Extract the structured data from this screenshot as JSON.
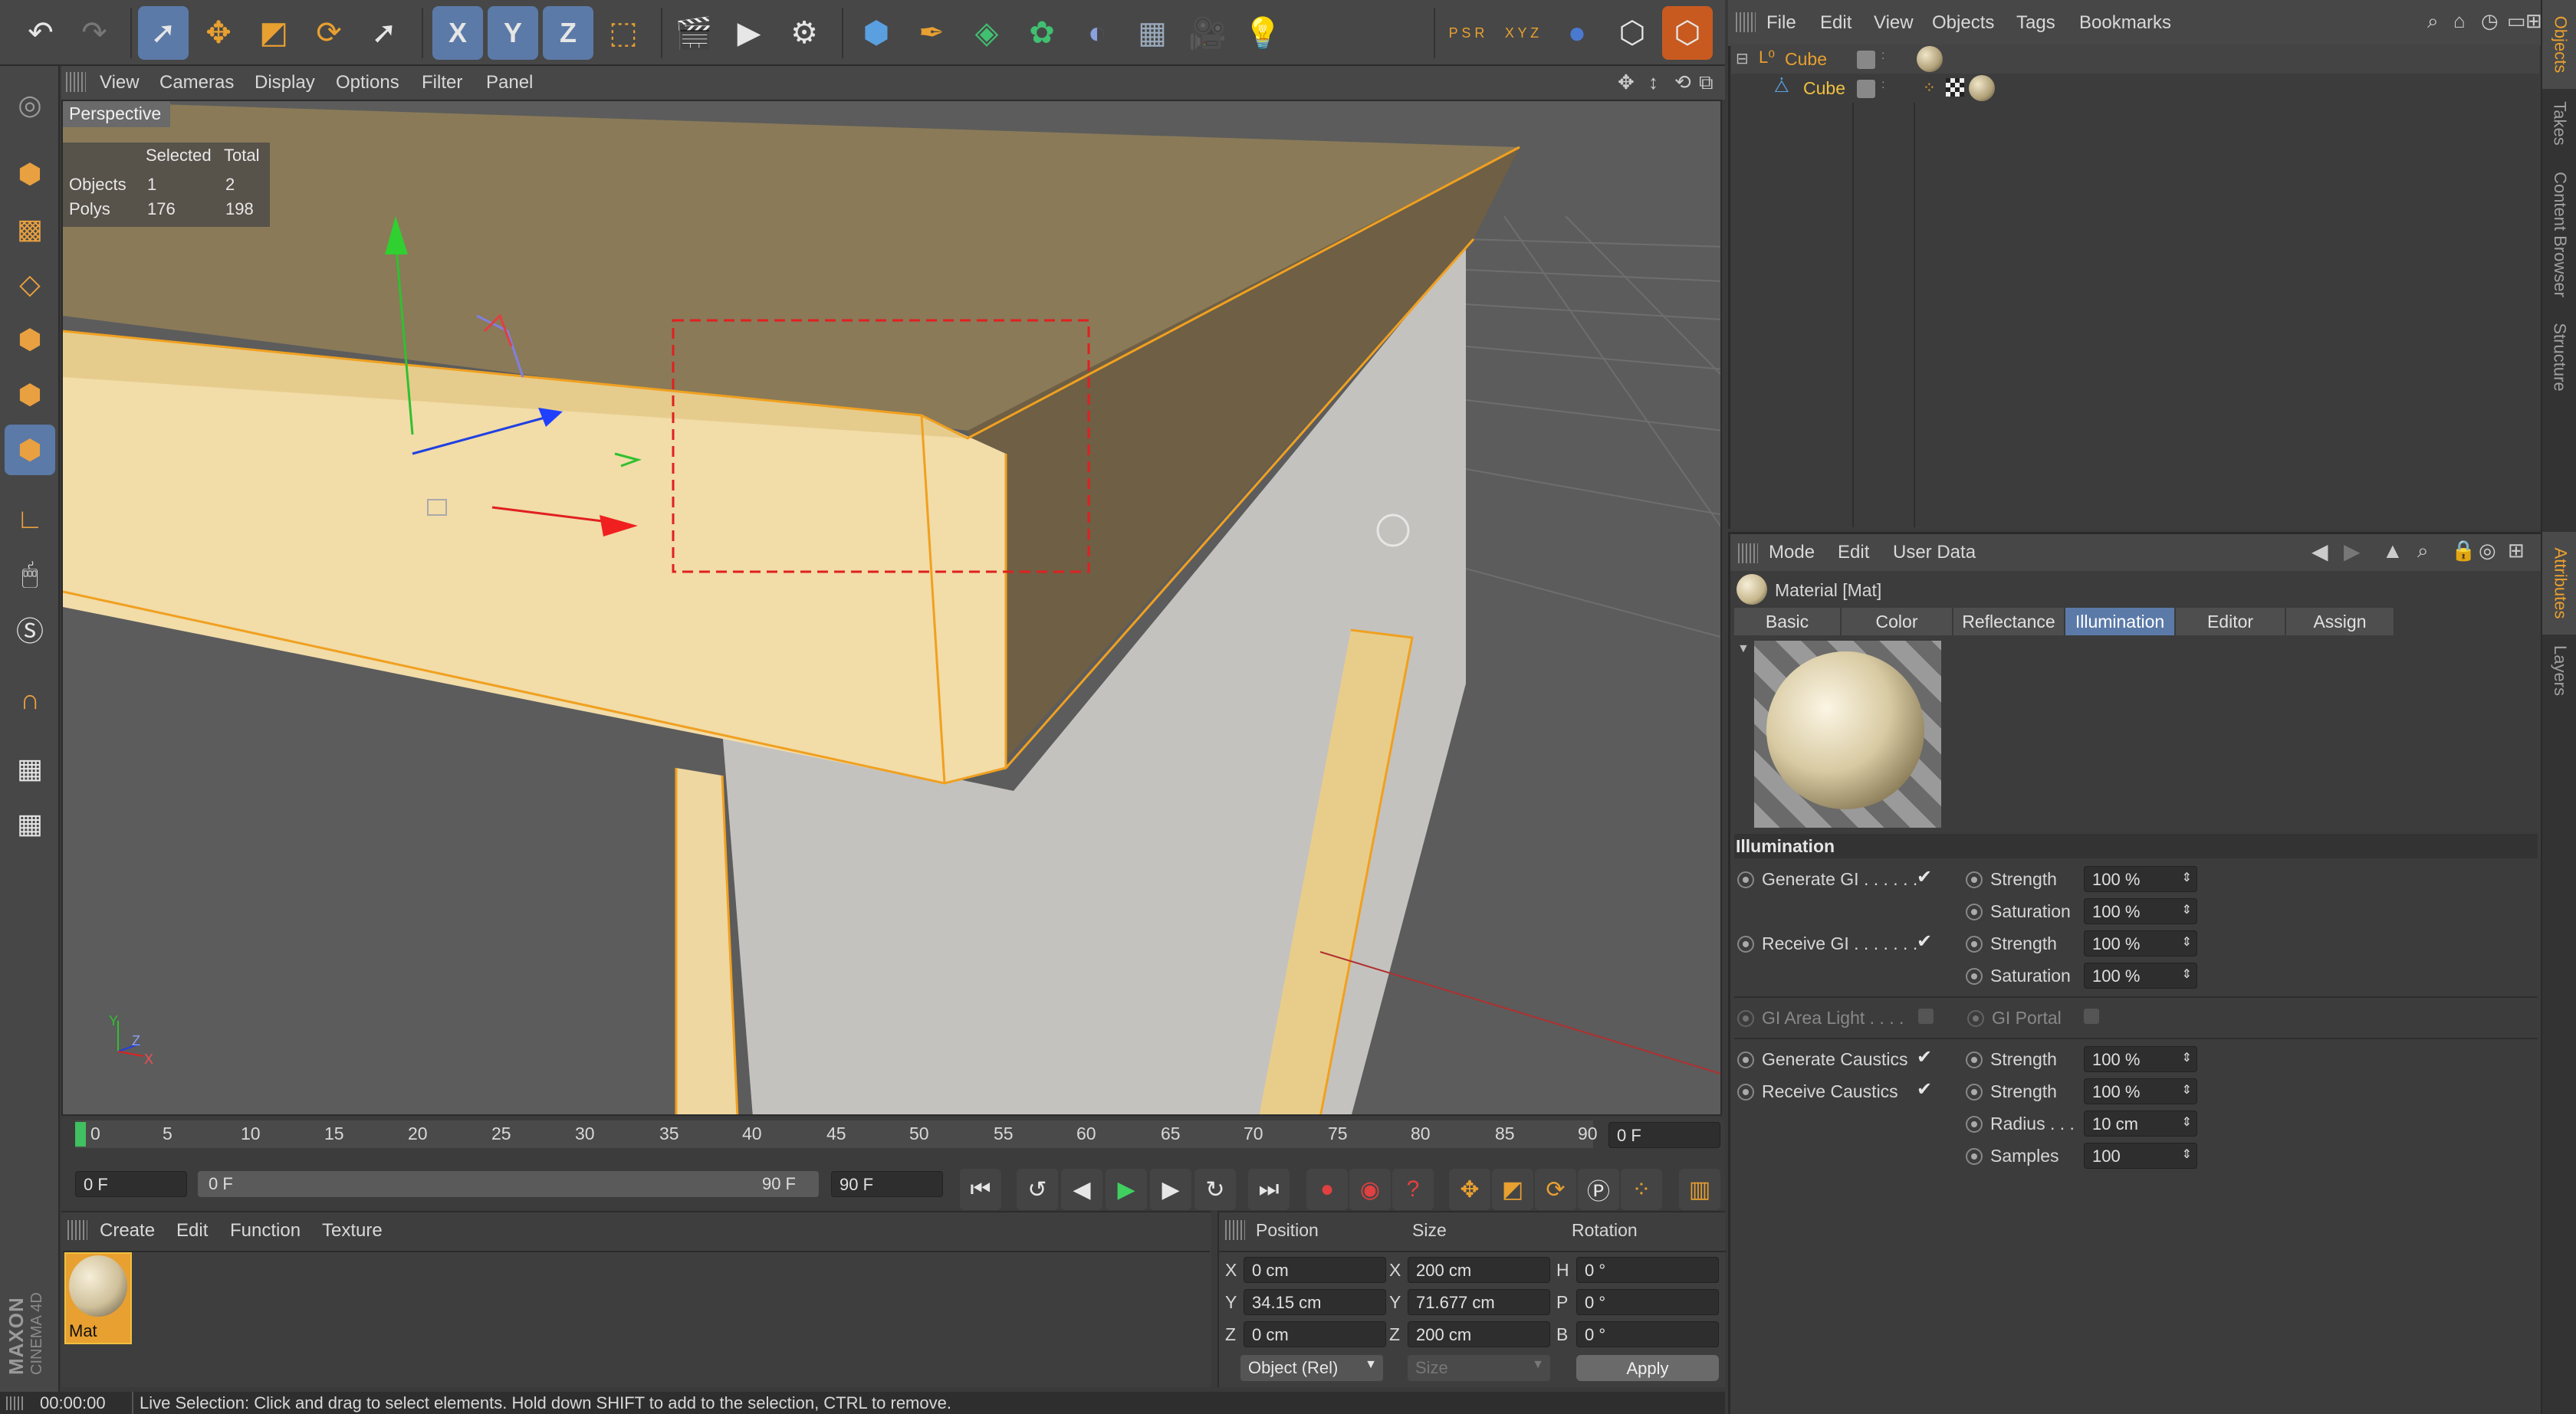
{
  "toolbar": {
    "axis_x": "X",
    "axis_y": "Y",
    "axis_z": "Z",
    "psr_label": "P S R",
    "xyz_label": "X Y Z"
  },
  "viewport": {
    "menu": [
      "View",
      "Cameras",
      "Display",
      "Options",
      "Filter",
      "Panel"
    ],
    "camera_label": "Perspective",
    "stats": {
      "col_selected": "Selected",
      "col_total": "Total",
      "rows": [
        {
          "label": "Objects",
          "selected": "1",
          "total": "2"
        },
        {
          "label": "Polys",
          "selected": "176",
          "total": "198"
        }
      ]
    },
    "axis_gizmo": {
      "y": "Y",
      "z": "Z",
      "x": "X"
    }
  },
  "timeline": {
    "ticks": [
      "0",
      "5",
      "10",
      "15",
      "20",
      "25",
      "30",
      "35",
      "40",
      "45",
      "50",
      "55",
      "60",
      "65",
      "70",
      "75",
      "80",
      "85",
      "90"
    ],
    "current_frame_field": "0 F",
    "start_field": "0 F",
    "range_start": "0 F",
    "range_end": "90 F",
    "end_field": "90 F"
  },
  "materials": {
    "menu": [
      "Create",
      "Edit",
      "Function",
      "Texture"
    ],
    "items": [
      {
        "name": "Mat"
      }
    ]
  },
  "coords": {
    "headers": {
      "position": "Position",
      "size": "Size",
      "rotation": "Rotation"
    },
    "rows": [
      {
        "pos_axis": "X",
        "pos": "0 cm",
        "size_axis": "X",
        "size": "200 cm",
        "rot_axis": "H",
        "rot": "0 °"
      },
      {
        "pos_axis": "Y",
        "pos": "34.15 cm",
        "size_axis": "Y",
        "size": "71.677 cm",
        "rot_axis": "P",
        "rot": "0 °"
      },
      {
        "pos_axis": "Z",
        "pos": "0 cm",
        "size_axis": "Z",
        "size": "200 cm",
        "rot_axis": "B",
        "rot": "0 °"
      }
    ],
    "mode_select": "Object (Rel)",
    "size_select": "Size",
    "apply_label": "Apply"
  },
  "status": {
    "time": "00:00:00",
    "message": "Live Selection: Click and drag to select elements. Hold down SHIFT to add to the selection, CTRL to remove."
  },
  "branding": {
    "line1": "MAXON",
    "line2": "CINEMA 4D"
  },
  "object_manager": {
    "menu": [
      "File",
      "Edit",
      "View",
      "Objects",
      "Tags",
      "Bookmarks"
    ],
    "objects": [
      {
        "name": "Cube",
        "level": 0
      },
      {
        "name": "Cube",
        "level": 1
      }
    ]
  },
  "attributes": {
    "menu": [
      "Mode",
      "Edit",
      "User Data"
    ],
    "title": "Material [Mat]",
    "tabs": [
      "Basic",
      "Color",
      "Reflectance",
      "Illumination",
      "Editor",
      "Assign"
    ],
    "active_tab": "Illumination",
    "section": "Illumination",
    "left_rows": [
      {
        "label": "Generate GI . . . . . .",
        "checked": true
      },
      {
        "label": "Receive GI . . . . . . .",
        "checked": true
      },
      {
        "label": "GI Area Light . . . .",
        "checked": false
      },
      {
        "label": "Generate Caustics",
        "checked": true
      },
      {
        "label": "Receive Caustics",
        "checked": true
      }
    ],
    "gi_portal": "GI Portal",
    "right_rows": [
      {
        "label": "Strength",
        "value": "100 %"
      },
      {
        "label": "Saturation",
        "value": "100 %"
      },
      {
        "label": "Strength",
        "value": "100 %"
      },
      {
        "label": "Saturation",
        "value": "100 %"
      },
      {
        "label": "Strength",
        "value": "100 %"
      },
      {
        "label": "Strength",
        "value": "100 %"
      },
      {
        "label": "Radius . . .",
        "value": "10 cm"
      },
      {
        "label": "Samples",
        "value": "100"
      }
    ]
  },
  "side_tabs": [
    "Objects",
    "Takes",
    "Content Browser",
    "Structure",
    "Attributes",
    "Layers"
  ],
  "colors": {
    "accent_blue": "#5b7aa8",
    "object_orange": "#e8a030",
    "highlight_yellow": "#f0c040"
  }
}
